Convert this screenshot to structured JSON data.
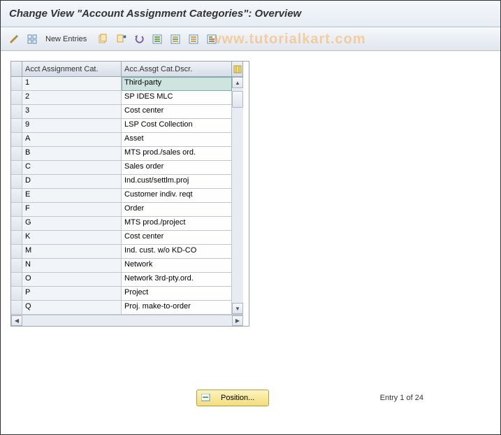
{
  "title": "Change View \"Account Assignment Categories\": Overview",
  "watermark": "www.tutorialkart.com",
  "toolbar": {
    "new_entries_label": "New Entries"
  },
  "table": {
    "columns": [
      "Acct Assignment Cat.",
      "Acc.Assgt Cat.Dscr."
    ],
    "rows": [
      {
        "cat": "1",
        "desc": "Third-party",
        "selected": true
      },
      {
        "cat": "2",
        "desc": "SP IDES MLC"
      },
      {
        "cat": "3",
        "desc": "Cost center"
      },
      {
        "cat": "9",
        "desc": "LSP Cost Collection"
      },
      {
        "cat": "A",
        "desc": "Asset"
      },
      {
        "cat": "B",
        "desc": "MTS prod./sales ord."
      },
      {
        "cat": "C",
        "desc": "Sales order"
      },
      {
        "cat": "D",
        "desc": "Ind.cust/settlm.proj"
      },
      {
        "cat": "E",
        "desc": "Customer indiv. reqt"
      },
      {
        "cat": "F",
        "desc": "Order"
      },
      {
        "cat": "G",
        "desc": "MTS prod./project"
      },
      {
        "cat": "K",
        "desc": "Cost center"
      },
      {
        "cat": "M",
        "desc": "Ind. cust. w/o KD-CO"
      },
      {
        "cat": "N",
        "desc": "Network"
      },
      {
        "cat": "O",
        "desc": "Network 3rd-pty.ord."
      },
      {
        "cat": "P",
        "desc": "Project"
      },
      {
        "cat": "Q",
        "desc": "Proj. make-to-order"
      }
    ]
  },
  "footer": {
    "position_label": "Position...",
    "entry_text": "Entry 1 of 24"
  }
}
